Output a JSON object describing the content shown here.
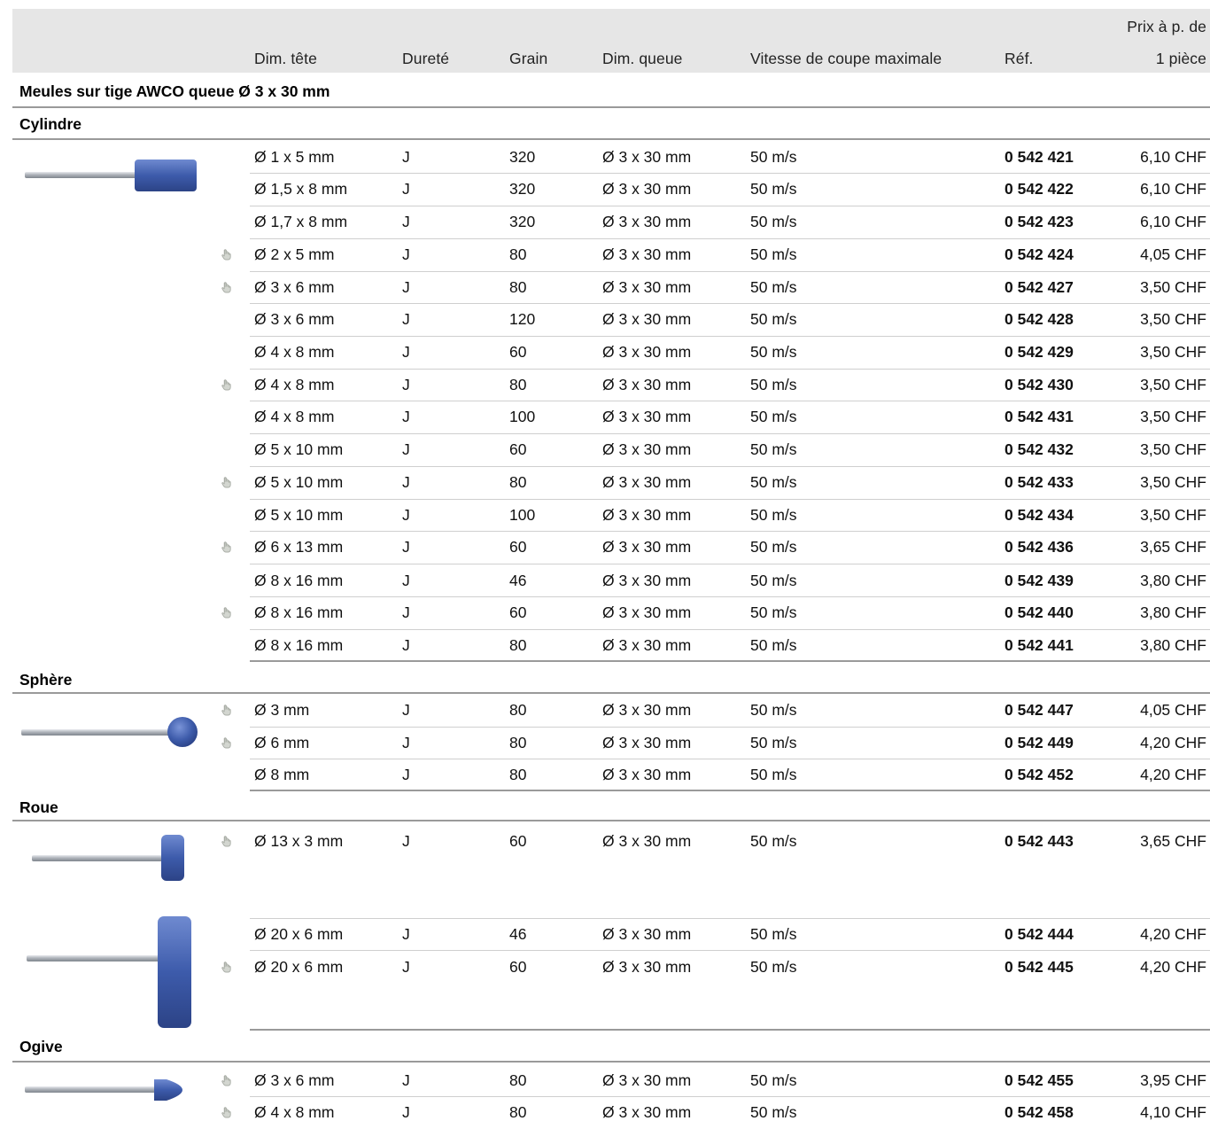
{
  "header": {
    "col_dim_tete": "Dim. tête",
    "col_durete": "Dureté",
    "col_grain": "Grain",
    "col_dim_queue": "Dim. queue",
    "col_vitesse": "Vitesse de coupe maximale",
    "col_ref": "Réf.",
    "col_prix_line1": "Prix à p. de",
    "col_prix_line2": "1 pièce"
  },
  "title": "Meules sur tige AWCO queue Ø 3 x 30 mm",
  "sections": {
    "cylindre": {
      "name": "Cylindre",
      "rows": [
        {
          "dim": "Ø 1 x 5 mm",
          "durete": "J",
          "grain": "320",
          "queue": "Ø 3 x 30 mm",
          "vitesse": "50 m/s",
          "ref": "0 542 421",
          "prix": "6,10 CHF"
        },
        {
          "dim": "Ø 1,5 x 8 mm",
          "durete": "J",
          "grain": "320",
          "queue": "Ø 3 x 30 mm",
          "vitesse": "50 m/s",
          "ref": "0 542 422",
          "prix": "6,10 CHF"
        },
        {
          "dim": "Ø 1,7 x 8 mm",
          "durete": "J",
          "grain": "320",
          "queue": "Ø 3 x 30 mm",
          "vitesse": "50 m/s",
          "ref": "0 542 423",
          "prix": "6,10 CHF"
        },
        {
          "dim": "Ø 2 x 5 mm",
          "durete": "J",
          "grain": "80",
          "queue": "Ø 3 x 30 mm",
          "vitesse": "50 m/s",
          "ref": "0 542 424",
          "prix": "4,05 CHF"
        },
        {
          "dim": "Ø 3 x 6 mm",
          "durete": "J",
          "grain": "80",
          "queue": "Ø 3 x 30 mm",
          "vitesse": "50 m/s",
          "ref": "0 542 427",
          "prix": "3,50 CHF"
        },
        {
          "dim": "Ø 3 x 6 mm",
          "durete": "J",
          "grain": "120",
          "queue": "Ø 3 x 30 mm",
          "vitesse": "50 m/s",
          "ref": "0 542 428",
          "prix": "3,50 CHF"
        },
        {
          "dim": "Ø 4 x 8 mm",
          "durete": "J",
          "grain": "60",
          "queue": "Ø 3 x 30 mm",
          "vitesse": "50 m/s",
          "ref": "0 542 429",
          "prix": "3,50 CHF"
        },
        {
          "dim": "Ø 4 x 8 mm",
          "durete": "J",
          "grain": "80",
          "queue": "Ø 3 x 30 mm",
          "vitesse": "50 m/s",
          "ref": "0 542 430",
          "prix": "3,50 CHF"
        },
        {
          "dim": "Ø 4 x 8 mm",
          "durete": "J",
          "grain": "100",
          "queue": "Ø 3 x 30 mm",
          "vitesse": "50 m/s",
          "ref": "0 542 431",
          "prix": "3,50 CHF"
        },
        {
          "dim": "Ø 5 x 10 mm",
          "durete": "J",
          "grain": "60",
          "queue": "Ø 3 x 30 mm",
          "vitesse": "50 m/s",
          "ref": "0 542 432",
          "prix": "3,50 CHF"
        },
        {
          "dim": "Ø 5 x 10 mm",
          "durete": "J",
          "grain": "80",
          "queue": "Ø 3 x 30 mm",
          "vitesse": "50 m/s",
          "ref": "0 542 433",
          "prix": "3,50 CHF"
        },
        {
          "dim": "Ø 5 x 10 mm",
          "durete": "J",
          "grain": "100",
          "queue": "Ø 3 x 30 mm",
          "vitesse": "50 m/s",
          "ref": "0 542 434",
          "prix": "3,50 CHF"
        },
        {
          "dim": "Ø 6 x 13 mm",
          "durete": "J",
          "grain": "60",
          "queue": "Ø 3 x 30 mm",
          "vitesse": "50 m/s",
          "ref": "0 542 436",
          "prix": "3,65 CHF"
        },
        {
          "dim": "Ø 8 x 16 mm",
          "durete": "J",
          "grain": "46",
          "queue": "Ø 3 x 30 mm",
          "vitesse": "50 m/s",
          "ref": "0 542 439",
          "prix": "3,80 CHF"
        },
        {
          "dim": "Ø 8 x 16 mm",
          "durete": "J",
          "grain": "60",
          "queue": "Ø 3 x 30 mm",
          "vitesse": "50 m/s",
          "ref": "0 542 440",
          "prix": "3,80 CHF"
        },
        {
          "dim": "Ø 8 x 16 mm",
          "durete": "J",
          "grain": "80",
          "queue": "Ø 3 x 30 mm",
          "vitesse": "50 m/s",
          "ref": "0 542 441",
          "prix": "3,80 CHF"
        }
      ]
    },
    "sphere": {
      "name": "Sphère",
      "rows": [
        {
          "dim": "Ø 3 mm",
          "durete": "J",
          "grain": "80",
          "queue": "Ø 3 x 30 mm",
          "vitesse": "50 m/s",
          "ref": "0 542 447",
          "prix": "4,05 CHF"
        },
        {
          "dim": "Ø 6 mm",
          "durete": "J",
          "grain": "80",
          "queue": "Ø 3 x 30 mm",
          "vitesse": "50 m/s",
          "ref": "0 542 449",
          "prix": "4,20 CHF"
        },
        {
          "dim": "Ø 8 mm",
          "durete": "J",
          "grain": "80",
          "queue": "Ø 3 x 30 mm",
          "vitesse": "50 m/s",
          "ref": "0 542 452",
          "prix": "4,20 CHF"
        }
      ]
    },
    "roue": {
      "name": "Roue",
      "rows": [
        {
          "dim": "Ø 13 x 3 mm",
          "durete": "J",
          "grain": "60",
          "queue": "Ø 3 x 30 mm",
          "vitesse": "50 m/s",
          "ref": "0 542 443",
          "prix": "3,65 CHF"
        },
        {
          "dim": "Ø 20 x 6 mm",
          "durete": "J",
          "grain": "46",
          "queue": "Ø 3 x 30 mm",
          "vitesse": "50 m/s",
          "ref": "0 542 444",
          "prix": "4,20 CHF"
        },
        {
          "dim": "Ø 20 x 6 mm",
          "durete": "J",
          "grain": "60",
          "queue": "Ø 3 x 30 mm",
          "vitesse": "50 m/s",
          "ref": "0 542 445",
          "prix": "4,20 CHF"
        }
      ]
    },
    "ogive": {
      "name": "Ogive",
      "rows": [
        {
          "dim": "Ø 3 x 6 mm",
          "durete": "J",
          "grain": "80",
          "queue": "Ø 3 x 30 mm",
          "vitesse": "50 m/s",
          "ref": "0 542 455",
          "prix": "3,95 CHF"
        },
        {
          "dim": "Ø 4 x 8 mm",
          "durete": "J",
          "grain": "80",
          "queue": "Ø 3 x 30 mm",
          "vitesse": "50 m/s",
          "ref": "0 542 458",
          "prix": "4,10 CHF"
        }
      ]
    }
  },
  "icons": {
    "hand": "hand-pointer-icon",
    "tool_cylindre": "cylinder-grinding-point-icon",
    "tool_sphere": "sphere-grinding-point-icon",
    "tool_roue_small": "wheel-grinding-point-icon",
    "tool_roue_large": "wheel-grinding-point-icon",
    "tool_ogive": "ogive-grinding-point-icon"
  },
  "colors": {
    "header_bg": "#e6e6e6",
    "stone_blue": "#3f5fae",
    "shaft_grey": "#b8bcc2"
  }
}
